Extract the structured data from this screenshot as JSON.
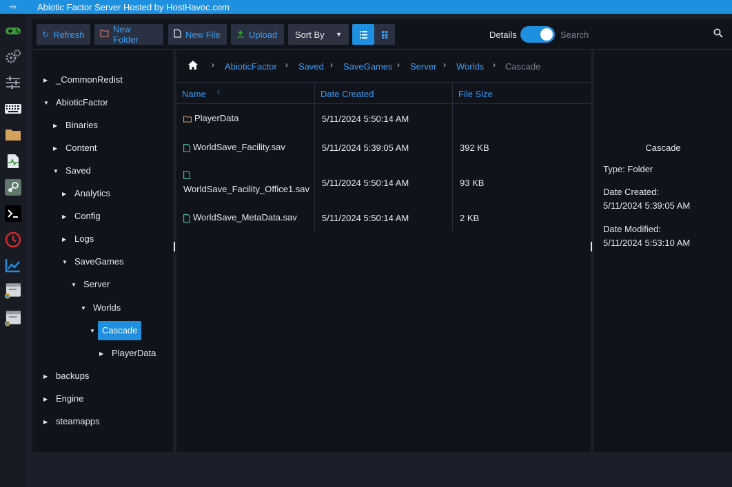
{
  "window": {
    "title": "Abiotic Factor Server Hosted by HostHavoc.com"
  },
  "rail": {
    "icons": [
      "gamepad-icon",
      "gears-icon",
      "sliders-icon",
      "keyboard-icon",
      "folder-icon",
      "activity-file-icon",
      "steam-icon",
      "terminal-icon",
      "clock-icon",
      "chart-icon",
      "window-badge-icon",
      "window-badge-icon-2"
    ]
  },
  "toolbar": {
    "refresh": "Refresh",
    "new_folder": "New Folder",
    "new_file": "New File",
    "upload": "Upload",
    "sort_by": "Sort By",
    "details_label": "Details",
    "details_on": true,
    "search_placeholder": "Search"
  },
  "tree": {
    "items": [
      {
        "label": "_CommonRedist"
      },
      {
        "label": "AbioticFactor"
      },
      {
        "label": "Binaries"
      },
      {
        "label": "Content"
      },
      {
        "label": "Saved"
      },
      {
        "label": "Analytics"
      },
      {
        "label": "Config"
      },
      {
        "label": "Logs"
      },
      {
        "label": "SaveGames"
      },
      {
        "label": "Server"
      },
      {
        "label": "Worlds"
      },
      {
        "label": "Cascade",
        "selected": true
      },
      {
        "label": "PlayerData"
      },
      {
        "label": "backups"
      },
      {
        "label": "Engine"
      },
      {
        "label": "steamapps"
      }
    ]
  },
  "breadcrumb": [
    "AbioticFactor",
    "Saved",
    "SaveGames",
    "Server",
    "Worlds",
    "Cascade"
  ],
  "table": {
    "columns": [
      "Name",
      "Date Created",
      "File Size"
    ],
    "sort_indicator": "↑",
    "rows": [
      {
        "name": "PlayerData",
        "type": "folder",
        "date": "5/11/2024 5:50:14 AM",
        "size": ""
      },
      {
        "name": "WorldSave_Facility.sav",
        "type": "file",
        "date": "5/11/2024 5:39:05 AM",
        "size": "392 KB"
      },
      {
        "name": "WorldSave_Facility_Office1.sav",
        "type": "file",
        "date": "5/11/2024 5:50:14 AM",
        "size": "93 KB"
      },
      {
        "name": "WorldSave_MetaData.sav",
        "type": "file",
        "date": "5/11/2024 5:50:14 AM",
        "size": "2 KB"
      }
    ]
  },
  "details": {
    "name": "Cascade",
    "type_line": "Type: Folder",
    "created_label": "Date Created:",
    "created_value": "5/11/2024 5:39:05 AM",
    "modified_label": "Date Modified:",
    "modified_value": "5/11/2024 5:53:10 AM"
  },
  "colors": {
    "accent": "#1f8fe0",
    "link": "#3d9bf0",
    "background": "#1c1e29",
    "panel": "#11131b"
  }
}
